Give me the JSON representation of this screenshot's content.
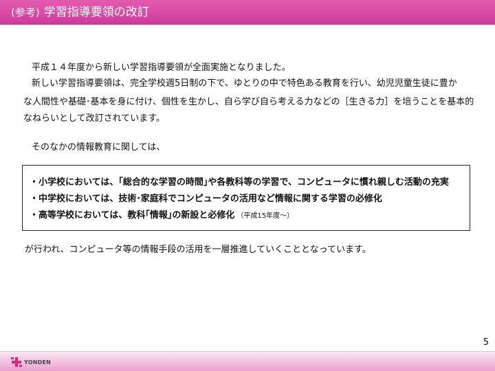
{
  "header": {
    "prefix": "(参考)",
    "title": "学習指導要領の改訂"
  },
  "body": {
    "para1": "平成１４年度から新しい学習指導要領が全面実施となりました。",
    "para2_line1": "新しい学習指導要領は、完全学校週5日制の下で、ゆとりの中で特色ある教育を行い、幼児児童生徒に豊か",
    "para2_line2": "な人間性や基礎･基本を身に付け、個性を生かし、自ら学び自ら考える力などの［生きる力］を培うことを基本的",
    "para2_line3": "なねらいとして改訂されています。",
    "para3": "そのなかの情報教育に関しては、",
    "box_items": [
      "・小学校においては、｢総合的な学習の時間｣や各教科等の学習で、コンピュータに慣れ親しむ活動の充実",
      "・中学校においては、技術･家庭科でコンピュータの活用など情報に関する学習の必修化",
      "・高等学校においては、教科｢情報｣の新設と必修化"
    ],
    "box_item3_note": "（平成15年度～）",
    "para4": "が行われ、コンピュータ等の情報手段の活用を一層推進していくこととなっています。"
  },
  "footer": {
    "page_number": "5",
    "logo_text": "YONDEN",
    "logo_icon": "yonden-logo-icon",
    "brand_color": "#e0267a",
    "header_color": "#d94aa6"
  }
}
